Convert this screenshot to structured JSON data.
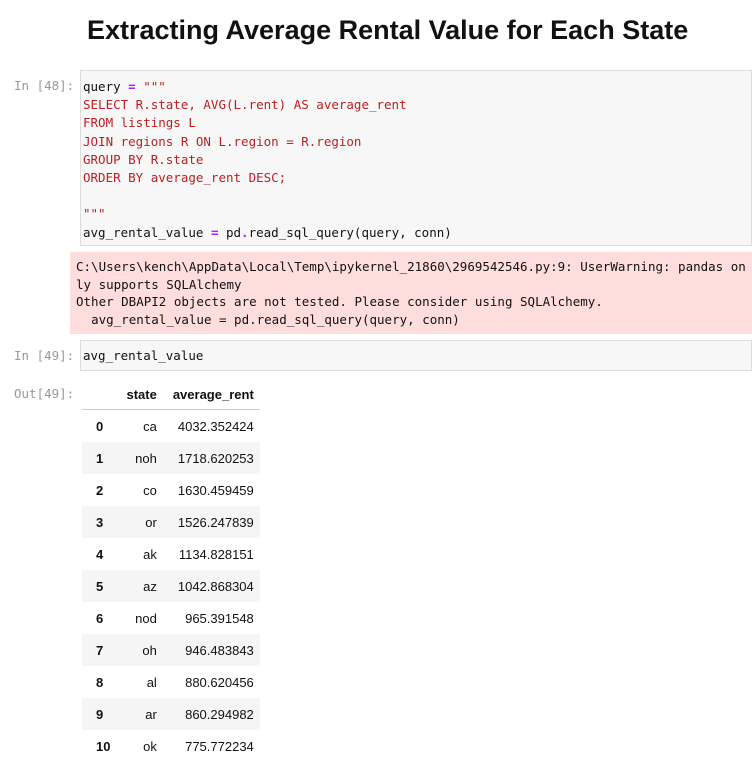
{
  "title": "Extracting Average Rental Value for Each State",
  "cell48": {
    "prompt": "In [48]:",
    "lines": [
      "SELECT R.state, AVG(L.rent) AS average_rent",
      "FROM listings L",
      "JOIN regions R ON L.region = R.region",
      "GROUP BY R.state",
      "ORDER BY average_rent DESC;"
    ],
    "l0a": "query ",
    "l0b": "=",
    "l0c": " \"\"\"",
    "close": "\"\"\"",
    "last_a": "avg_rental_value ",
    "last_b": "=",
    "last_c": " pd",
    "last_d": ".",
    "last_e": "read_sql_query(query, conn)"
  },
  "warning": [
    "C:\\Users\\kench\\AppData\\Local\\Temp\\ipykernel_21860\\2969542546.py:9: UserWarning: pandas only supports SQLAlchemy",
    "Other DBAPI2 objects are not tested. Please consider using SQLAlchemy.",
    "  avg_rental_value = pd.read_sql_query(query, conn)"
  ],
  "cell49": {
    "prompt": "In [49]:",
    "code": "avg_rental_value",
    "out": "Out[49]:"
  },
  "table": {
    "headers": [
      "",
      "state",
      "average_rent"
    ],
    "rows": [
      [
        "0",
        "ca",
        "4032.352424"
      ],
      [
        "1",
        "noh",
        "1718.620253"
      ],
      [
        "2",
        "co",
        "1630.459459"
      ],
      [
        "3",
        "or",
        "1526.247839"
      ],
      [
        "4",
        "ak",
        "1134.828151"
      ],
      [
        "5",
        "az",
        "1042.868304"
      ],
      [
        "6",
        "nod",
        "965.391548"
      ],
      [
        "7",
        "oh",
        "946.483843"
      ],
      [
        "8",
        "al",
        "880.620456"
      ],
      [
        "9",
        "ar",
        "860.294982"
      ],
      [
        "10",
        "ok",
        "775.772234"
      ]
    ]
  }
}
